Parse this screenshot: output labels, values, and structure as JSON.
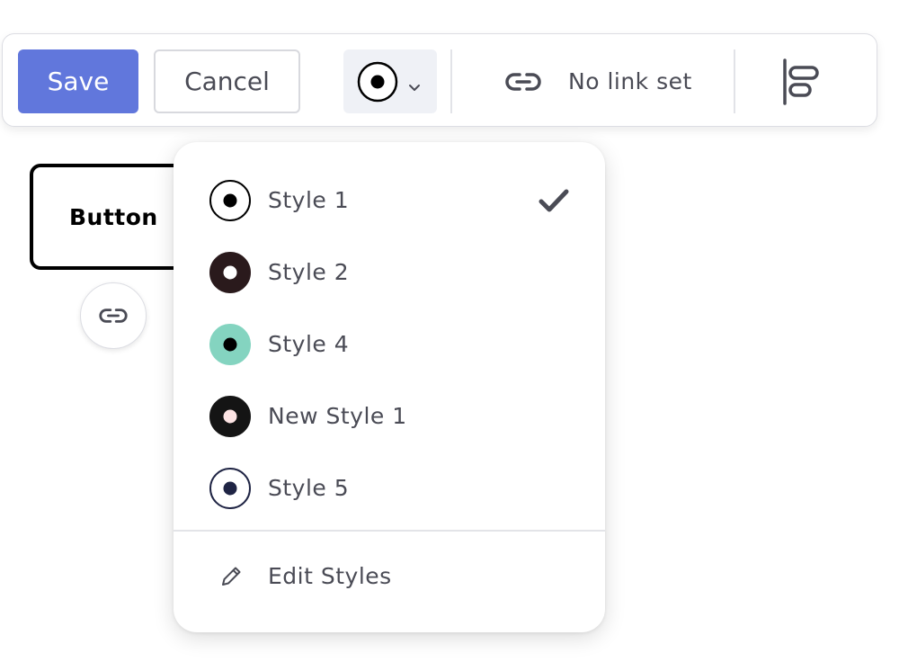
{
  "toolbar": {
    "save_label": "Save",
    "cancel_label": "Cancel",
    "style_trigger_icon": "radio-dot-icon",
    "link_icon": "link-icon",
    "link_text": "No link set",
    "align_icon": "align-left-icon"
  },
  "canvas": {
    "button_label": "Button",
    "link_icon": "link-icon"
  },
  "dropdown": {
    "items": [
      {
        "label": "Style 1",
        "ring": "#000000",
        "fill": "#ffffff",
        "dot": "#000000",
        "selected": true
      },
      {
        "label": "Style 2",
        "ring": "#2a1a1c",
        "fill": "#2a1a1c",
        "dot": "#ffffff",
        "selected": false
      },
      {
        "label": "Style 4",
        "ring": "#84d4c0",
        "fill": "#84d4c0",
        "dot": "#000000",
        "selected": false
      },
      {
        "label": "New Style 1",
        "ring": "#141414",
        "fill": "#141414",
        "dot": "#fde4e4",
        "selected": false
      },
      {
        "label": "Style 5",
        "ring": "#1f2444",
        "fill": "#ffffff",
        "dot": "#1f2444",
        "selected": false
      }
    ],
    "check_icon": "checkmark-icon",
    "edit_icon": "pencil-icon",
    "edit_label": "Edit Styles"
  },
  "colors": {
    "primary": "#6177dc",
    "text": "#4a4b55",
    "trigger_bg": "#eff1f6"
  }
}
